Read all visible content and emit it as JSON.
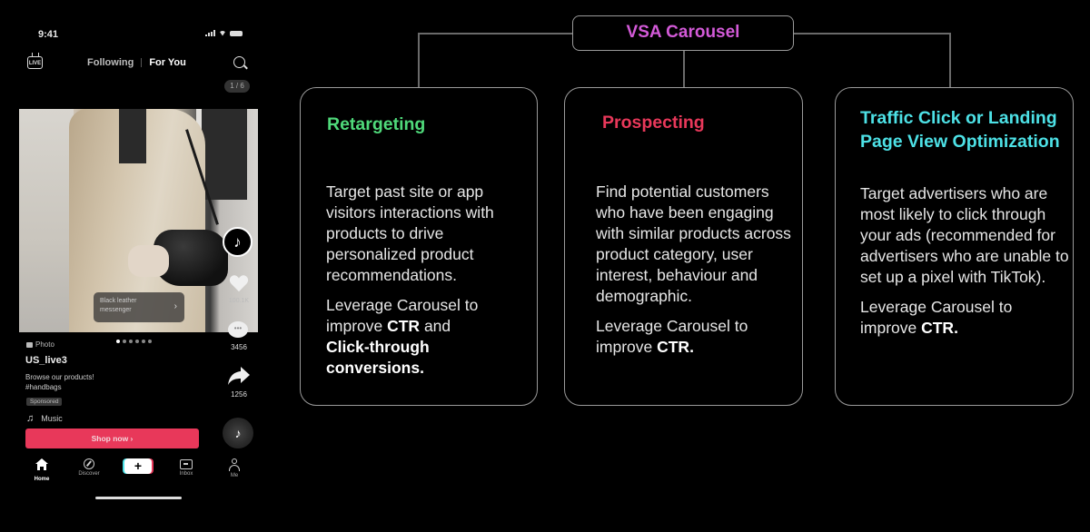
{
  "phone": {
    "status": {
      "time": "9:41"
    },
    "top_nav": {
      "live_label": "LIVE",
      "following": "Following",
      "for_you": "For You",
      "counter": "1 / 6"
    },
    "media": {
      "product_tag": "Black leather messenger",
      "product_tag_chevron": "›",
      "carousel_dots": 6,
      "active_dot": 1
    },
    "side_actions": {
      "likes": "100.1K",
      "comments": "3456",
      "shares": "1256",
      "comment_glyph": "•••"
    },
    "post": {
      "type_label": "Photo",
      "username": "US_live3",
      "caption_line1": "Browse our products!",
      "caption_line2": "#handbags",
      "sponsored": "Sponsored",
      "music": "Music",
      "cta": "Shop now ›"
    },
    "tabbar": [
      {
        "label": "Home",
        "icon": "home-icon",
        "active": true
      },
      {
        "label": "Discover",
        "icon": "compass-icon",
        "active": false
      },
      {
        "label": "+",
        "icon": "create-icon",
        "active": false
      },
      {
        "label": "Inbox",
        "icon": "inbox-icon",
        "active": false
      },
      {
        "label": "Me",
        "icon": "profile-icon",
        "active": false
      }
    ]
  },
  "diagram": {
    "root": {
      "label": "VSA Carousel",
      "color": "#d35ad8"
    },
    "cards": [
      {
        "title": "Retargeting",
        "title_color": "#4fd97a",
        "para1": "Target past site or app visitors interactions with products to drive personalized product recommendations.",
        "para2_prefix": "Leverage Carousel to improve ",
        "para2_bold1": "CTR",
        "para2_mid": " and ",
        "para2_bold2": "Click-through conversions."
      },
      {
        "title": "Prospecting",
        "title_color": "#e8385a",
        "para1": "Find potential customers who have been engaging with similar products across product category, user interest, behaviour and demographic.",
        "para2_prefix": "Leverage Carousel to improve ",
        "para2_bold1": "CTR."
      },
      {
        "title": "Traffic Click or Landing Page View Optimization",
        "title_color": "#4de1e6",
        "para1": "Target advertisers who are most likely to click through your ads (recommended for advertisers who are unable to set up a pixel with TikTok).",
        "para2_prefix": "Leverage Carousel to improve ",
        "para2_bold1": "CTR."
      }
    ]
  }
}
